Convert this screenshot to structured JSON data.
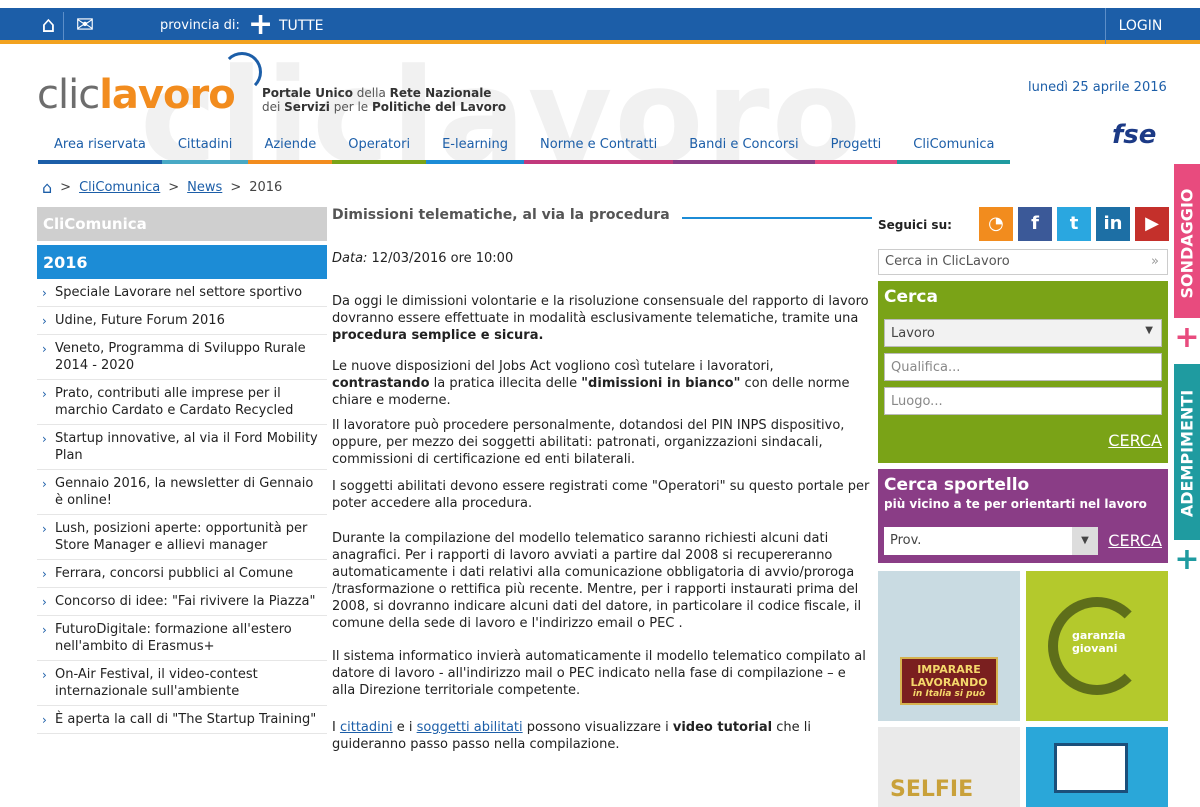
{
  "topbar": {
    "province_label": "provincia di:",
    "province_value": "TUTTE",
    "login": "LOGIN"
  },
  "logo": {
    "part1": "clic",
    "part2": "lavoro"
  },
  "tagline": {
    "l1a": "Portale Unico",
    "l1b": " della ",
    "l1c": "Rete Nazionale",
    "l2a": "dei ",
    "l2b": "Servizi",
    "l2c": " per le ",
    "l2d": "Politiche del Lavoro"
  },
  "date": "lunedì 25 aprile 2016",
  "fse": "fse",
  "nav": [
    "Area riservata",
    "Cittadini",
    "Aziende",
    "Operatori",
    "E-learning",
    "Norme e Contratti",
    "Bandi e Concorsi",
    "Progetti",
    "CliComunica"
  ],
  "nav_colors": [
    "#1c5ea8",
    "#48a9c5",
    "#f28c1e",
    "#7aa317",
    "#1c8cd6",
    "#c1397c",
    "#8a3d86",
    "#e84b7e",
    "#1f9ba0"
  ],
  "breadcrumb": {
    "sep": ">",
    "l1": "CliComunica",
    "l2": "News",
    "current": "2016"
  },
  "sidebar": {
    "section": "CliComunica",
    "year": "2016",
    "items": [
      "Speciale Lavorare nel settore sportivo",
      "Udine, Future Forum 2016",
      "Veneto, Programma di Sviluppo Rurale 2014 - 2020",
      "Prato, contributi alle imprese per il marchio Cardato e Cardato Recycled",
      "Startup innovative, al via il Ford Mobility Plan",
      "Gennaio 2016, la newsletter di Gennaio è online!",
      "Lush, posizioni aperte: opportunità per Store Manager e allievi manager",
      "Ferrara, concorsi pubblici al Comune",
      "Concorso di idee: \"Fai rivivere la Piazza\"",
      "FuturoDigitale: formazione all'estero nell'ambito di Erasmus+",
      "On-Air Festival, il video-contest internazionale sull'ambiente",
      "È aperta la call di \"The Startup Training\""
    ]
  },
  "article": {
    "title": "Dimissioni telematiche, al via la procedura",
    "date_label": "Data:",
    "date_value": " 12/03/2016 ore 10:00",
    "p1a": "Da oggi le dimissioni volontarie e la risoluzione consensuale del rapporto di lavoro dovranno essere effettuate in modalità esclusivamente telematiche, tramite una ",
    "p1b": "procedura semplice e sicura.",
    "p2a": "Le nuove disposizioni del Jobs Act vogliono così tutelare i lavoratori, ",
    "p2b": "contrastando",
    "p2c": " la pratica illecita delle ",
    "p2d": "\"dimissioni in bianco\"",
    "p2e": "  con delle norme chiare e moderne.",
    "p3": "Il lavoratore può procedere personalmente, dotandosi del PIN INPS dispositivo, oppure, per mezzo dei soggetti abilitati: patronati, organizzazioni sindacali, commissioni di certificazione ed enti bilaterali.",
    "p4": "I soggetti abilitati devono essere registrati come \"Operatori\" su questo portale per poter accedere alla procedura.",
    "p5": "Durante la compilazione del modello telematico saranno richiesti alcuni dati anagrafici. Per i rapporti di lavoro avviati a partire dal 2008 si recupereranno automaticamente i dati relativi alla comunicazione obbligatoria di avvio/proroga /trasformazione o rettifica più recente. Mentre, per i rapporti instaurati prima del 2008, si dovranno indicare alcuni dati del datore, in particolare il codice fiscale, il comune della sede di lavoro e l'indirizzo email o PEC .",
    "p6": "Il sistema informatico invierà automaticamente il modello telematico compilato al datore di lavoro - all'indirizzo mail o PEC indicato nella fase di compilazione – e alla Direzione territoriale competente.",
    "p7a": "I ",
    "p7b": "cittadini",
    "p7c": " e i ",
    "p7d": "soggetti abilitati",
    "p7e": " possono visualizzare i ",
    "p7f": "video tutorial",
    "p7g": " che li guideranno passo passo nella compilazione."
  },
  "right": {
    "follow": "Seguici su:",
    "search_placeholder": "Cerca in ClicLavoro",
    "search_go": "»",
    "cerca_title": "Cerca",
    "cerca_select": "Lavoro",
    "qualifica": "Qualifica...",
    "luogo": "Luogo...",
    "cerca_btn": "CERCA",
    "sport_title": "Cerca sportello",
    "sport_sub": "più vicino a te per orientarti nel lavoro",
    "sport_select": "Prov.",
    "sport_btn": "CERCA",
    "banner1": "IMPARARE LAVORANDO",
    "banner1b": "in Italia si può",
    "banner2": "garanzia giovani",
    "banner3": "SELFIE"
  },
  "tabs": {
    "t1": "SONDAGGIO",
    "t2": "ADEMPIMENTI",
    "plus": "+"
  },
  "social": [
    {
      "name": "rss",
      "color": "#f28c1e",
      "glyph": "◔"
    },
    {
      "name": "facebook",
      "color": "#3b5998",
      "glyph": "f"
    },
    {
      "name": "twitter",
      "color": "#2aa7e0",
      "glyph": "t"
    },
    {
      "name": "linkedin",
      "color": "#1d6fa5",
      "glyph": "in"
    },
    {
      "name": "youtube",
      "color": "#c4302b",
      "glyph": "▶"
    }
  ]
}
